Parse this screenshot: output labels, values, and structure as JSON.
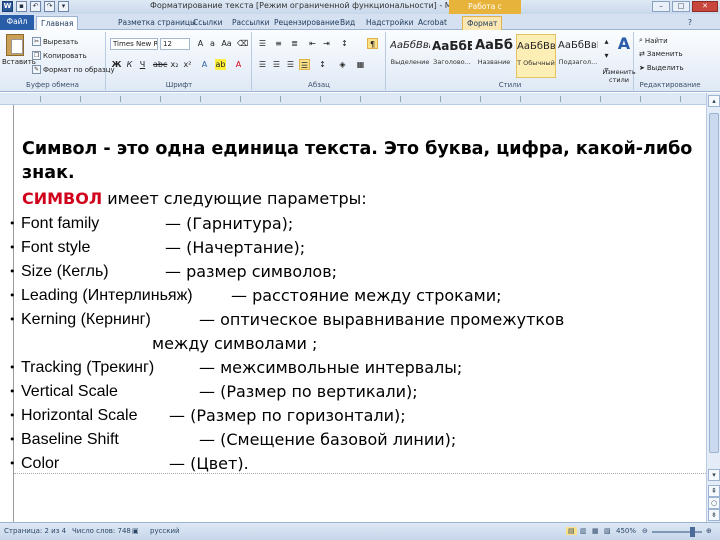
{
  "window": {
    "title": "Форматирование текста [Режим ограниченной функциональности] - Microsoft Word",
    "context_tab_header": "Работа с рисунками"
  },
  "tabs": [
    {
      "label": "Файл"
    },
    {
      "label": "Главная"
    },
    {
      "label": "Разметка страницы"
    },
    {
      "label": "Ссылки"
    },
    {
      "label": "Рассылки"
    },
    {
      "label": "Рецензирование"
    },
    {
      "label": "Вид"
    },
    {
      "label": "Надстройки"
    },
    {
      "label": "Acrobat"
    },
    {
      "label": "Формат"
    }
  ],
  "ribbon": {
    "clipboard": {
      "paste": "Вставить",
      "cut": "Вырезать",
      "copy": "Копировать",
      "format_painter": "Формат по образцу",
      "label": "Буфер обмена"
    },
    "font": {
      "font_name": "Times New Rc",
      "font_size": "12",
      "label": "Шрифт"
    },
    "paragraph": {
      "label": "Абзац"
    },
    "styles": {
      "label": "Стили",
      "items": [
        {
          "sample": "АаБбВвГ",
          "name": "Выделение"
        },
        {
          "sample": "АаБбЕ",
          "name": "Заголово..."
        },
        {
          "sample": "АаБб",
          "name": "Название"
        },
        {
          "sample": "АаБбВвГ",
          "name": "Т Обычный"
        },
        {
          "sample": "АаБбВвГ",
          "name": "Подзагол..."
        }
      ],
      "change_styles": "Изменить стили"
    },
    "editing": {
      "find": "Найти",
      "replace": "Заменить",
      "select": "Выделить",
      "label": "Редактирование"
    }
  },
  "document": {
    "heading": "Символ - это одна единица текста. Это буква, цифра, какой-либо знак.",
    "intro_red": "СИМВОЛ",
    "intro_rest": " имеет следующие параметры:",
    "params": [
      {
        "name": "Font family",
        "desc": "— (Гарнитура);"
      },
      {
        "name": "Font style",
        "desc": "— (Начертание);"
      },
      {
        "name": "Size (Кегль)",
        "desc": "— размер символов;"
      },
      {
        "name": "Leading (Интерлиньяж)",
        "desc": "— расстояние между строками;"
      },
      {
        "name": "Kerning (Кернинг)",
        "desc": "— оптическое выравнивание промежутков"
      },
      {
        "name": "Tracking (Трекинг)",
        "desc": "— межсимвольные интервалы;"
      },
      {
        "name": "Vertical Scale",
        "desc": "— (Размер по вертикали);"
      },
      {
        "name": "Horizontal Scale",
        "desc": "— (Размер по горизонтали);"
      },
      {
        "name": "Baseline Shift",
        "desc": "— (Смещение базовой линии);"
      },
      {
        "name": "Color",
        "desc": "— (Цвет)."
      }
    ],
    "kerning_continuation": "между символами ;"
  },
  "status": {
    "page": "Страница: 2 из 4",
    "words": "Число слов: 748",
    "language": "русский",
    "zoom": "450%"
  }
}
